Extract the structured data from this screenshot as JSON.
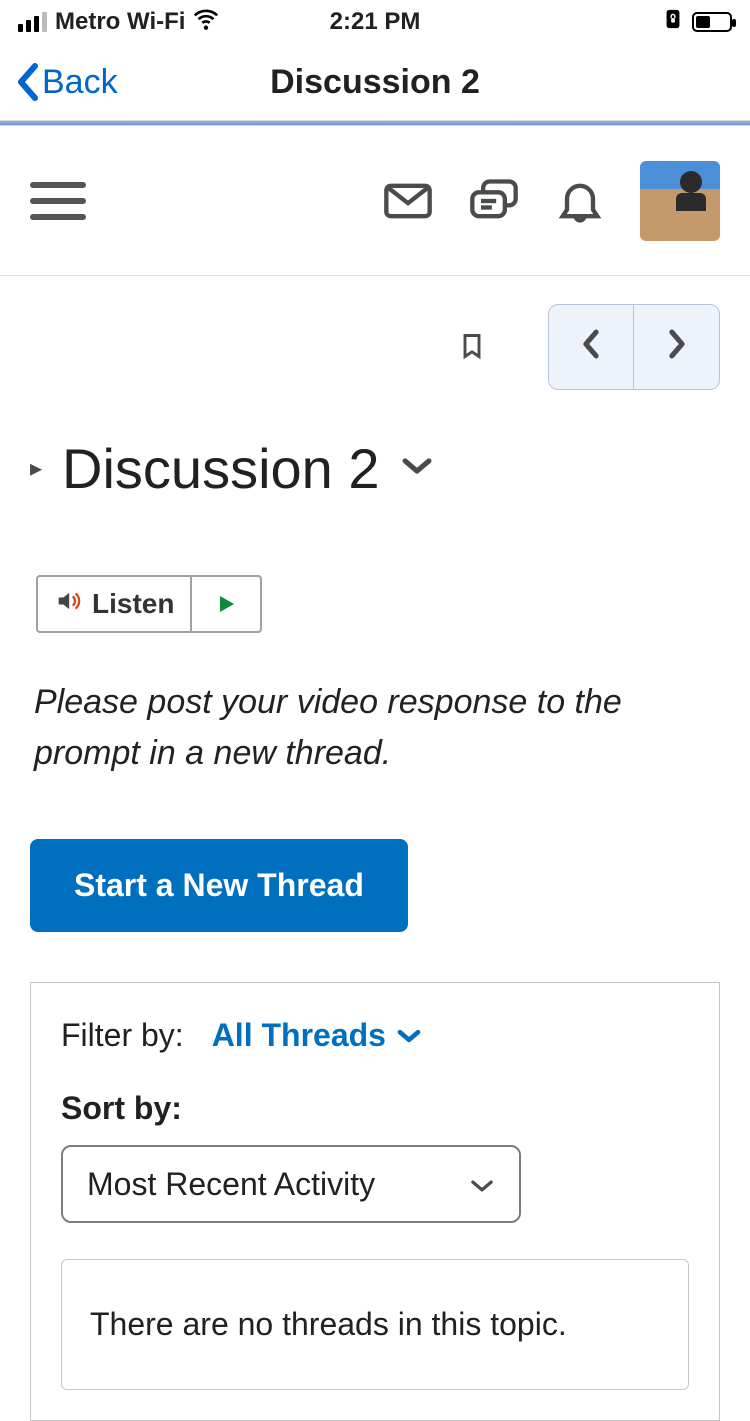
{
  "statusbar": {
    "carrier": "Metro Wi-Fi",
    "time": "2:21 PM"
  },
  "nav": {
    "back": "Back",
    "title": "Discussion 2"
  },
  "page": {
    "title": "Discussion 2"
  },
  "listen": {
    "label": "Listen"
  },
  "instructions": "Please post your video response to the prompt in a new thread.",
  "actions": {
    "start_thread": "Start a New Thread"
  },
  "filter": {
    "label": "Filter by:",
    "value": "All Threads"
  },
  "sort": {
    "label": "Sort by:",
    "value": "Most Recent Activity"
  },
  "threads": {
    "empty": "There are no threads in this topic."
  }
}
